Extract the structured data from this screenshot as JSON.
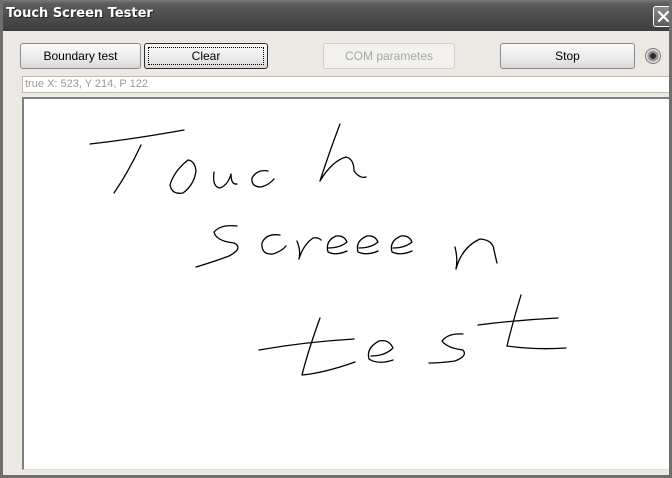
{
  "window": {
    "title": "Touch Screen Tester",
    "close_glyph": "✕"
  },
  "toolbar": {
    "boundary_test_label": "Boundary test",
    "clear_label": "Clear",
    "com_parameters_label": "COM parametes",
    "com_parameters_enabled": false,
    "stop_label": "Stop",
    "status_indicator_icon": "led-indicator-icon"
  },
  "status": {
    "readout": "true X: 523, Y 214, P 122"
  },
  "canvas": {
    "background": "#ffffff",
    "ink_color": "#000000",
    "handwritten_content": "Touch screen test"
  }
}
